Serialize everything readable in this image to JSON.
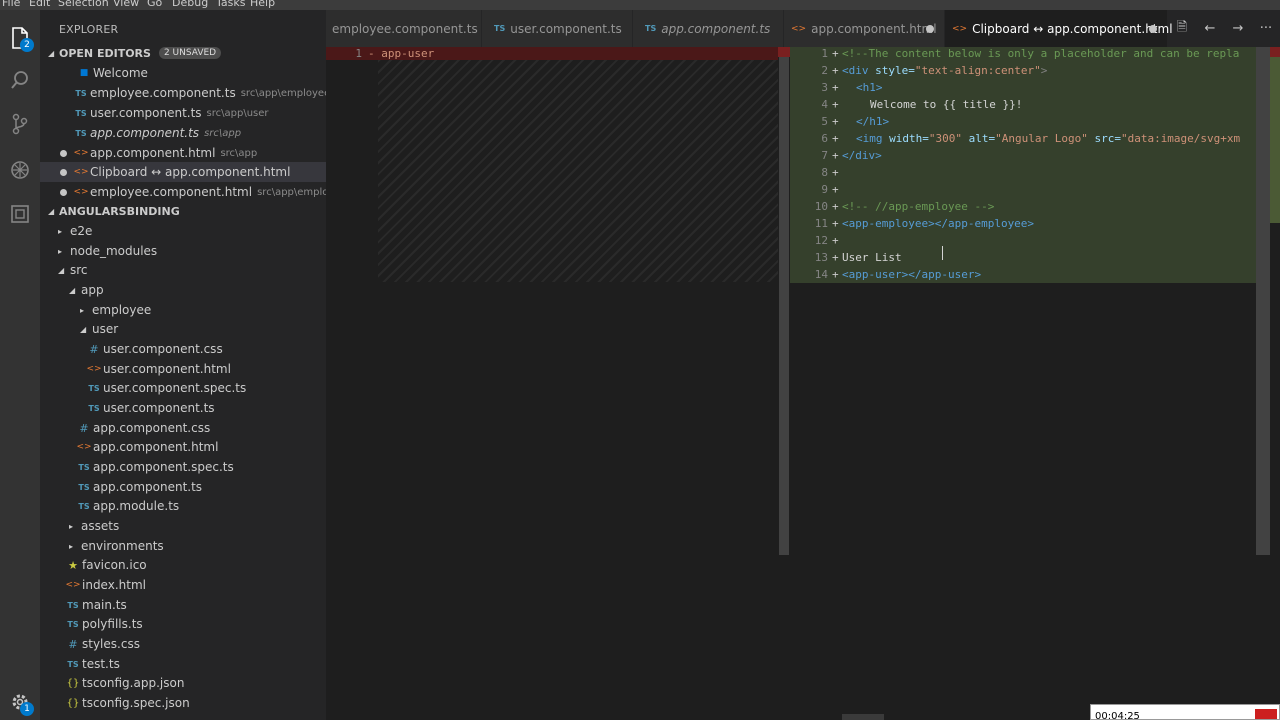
{
  "menu": [
    "File",
    "Edit",
    "Selection",
    "View",
    "Go",
    "Debug",
    "Tasks",
    "Help"
  ],
  "activity": {
    "explorer_badge": "2",
    "settings_badge": "1"
  },
  "sidebar": {
    "title": "EXPLORER",
    "open_editors": {
      "label": "OPEN EDITORS",
      "unsaved_badge": "2 UNSAVED",
      "items": [
        {
          "name": "Welcome",
          "path": "",
          "icon": "vscode-icon"
        },
        {
          "name": "employee.component.ts",
          "path": "src\\app\\employee",
          "icon": "ts-icon"
        },
        {
          "name": "user.component.ts",
          "path": "src\\app\\user",
          "icon": "ts-icon"
        },
        {
          "name": "app.component.ts",
          "path": "src\\app",
          "icon": "ts-icon"
        },
        {
          "name": "app.component.html",
          "path": "src\\app",
          "icon": "html-icon"
        },
        {
          "name": "Clipboard ↔ app.component.html",
          "path": "",
          "icon": "html-icon"
        },
        {
          "name": "employee.component.html",
          "path": "src\\app\\employee",
          "icon": "html-icon"
        }
      ]
    },
    "project": {
      "label": "ANGULARSBINDING",
      "tree": [
        {
          "name": "e2e",
          "type": "folder"
        },
        {
          "name": "node_modules",
          "type": "folder"
        },
        {
          "name": "src",
          "type": "folder-open"
        },
        {
          "name": "app",
          "type": "folder-open"
        },
        {
          "name": "employee",
          "type": "folder"
        },
        {
          "name": "user",
          "type": "folder-open"
        },
        {
          "name": "user.component.css",
          "type": "css"
        },
        {
          "name": "user.component.html",
          "type": "html"
        },
        {
          "name": "user.component.spec.ts",
          "type": "ts"
        },
        {
          "name": "user.component.ts",
          "type": "ts"
        },
        {
          "name": "app.component.css",
          "type": "css"
        },
        {
          "name": "app.component.html",
          "type": "html"
        },
        {
          "name": "app.component.spec.ts",
          "type": "ts"
        },
        {
          "name": "app.component.ts",
          "type": "ts"
        },
        {
          "name": "app.module.ts",
          "type": "ts"
        },
        {
          "name": "assets",
          "type": "folder"
        },
        {
          "name": "environments",
          "type": "folder"
        },
        {
          "name": "favicon.ico",
          "type": "star"
        },
        {
          "name": "index.html",
          "type": "html"
        },
        {
          "name": "main.ts",
          "type": "ts"
        },
        {
          "name": "polyfills.ts",
          "type": "ts"
        },
        {
          "name": "styles.css",
          "type": "css"
        },
        {
          "name": "test.ts",
          "type": "ts"
        },
        {
          "name": "tsconfig.app.json",
          "type": "json"
        },
        {
          "name": "tsconfig.spec.json",
          "type": "json"
        }
      ]
    }
  },
  "tabs": [
    {
      "label": "employee.component.ts",
      "icon": "ts-icon"
    },
    {
      "label": "user.component.ts",
      "icon": "ts-icon"
    },
    {
      "label": "app.component.ts",
      "icon": "ts-icon"
    },
    {
      "label": "app.component.html",
      "icon": "html-icon"
    },
    {
      "label": "Clipboard ↔ app.component.html",
      "icon": "html-icon"
    }
  ],
  "diff_left": {
    "line_number": "1",
    "code": "- app-user"
  },
  "diff_right": {
    "line_numbers": [
      "1",
      "2",
      "3",
      "4",
      "5",
      "6",
      "7",
      "8",
      "9",
      "10",
      "11",
      "12",
      "13",
      "14"
    ],
    "lines": {
      "l1": "<!--The content below is only a placeholder and can be repla",
      "l2_tag_open": "<div",
      "l2_attr": " style=",
      "l2_val": "\"text-align:center\"",
      "l2_close": ">",
      "l3": "<h1>",
      "l4": "Welcome to {{ title }}!",
      "l5": "</h1>",
      "l6_tag": "<img",
      "l6_attr1": " width=",
      "l6_val1": "\"300\"",
      "l6_attr2": " alt=",
      "l6_val2": "\"Angular Logo\"",
      "l6_attr3": " src=",
      "l6_val3": "\"data:image/svg+xm",
      "l7": "</div>",
      "l10": "<!-- //app-employee -->",
      "l11": "<app-employee></app-employee>",
      "l13": "User List",
      "l14": "<app-user></app-user>"
    }
  },
  "overlay": {
    "time": "00:04:25"
  }
}
